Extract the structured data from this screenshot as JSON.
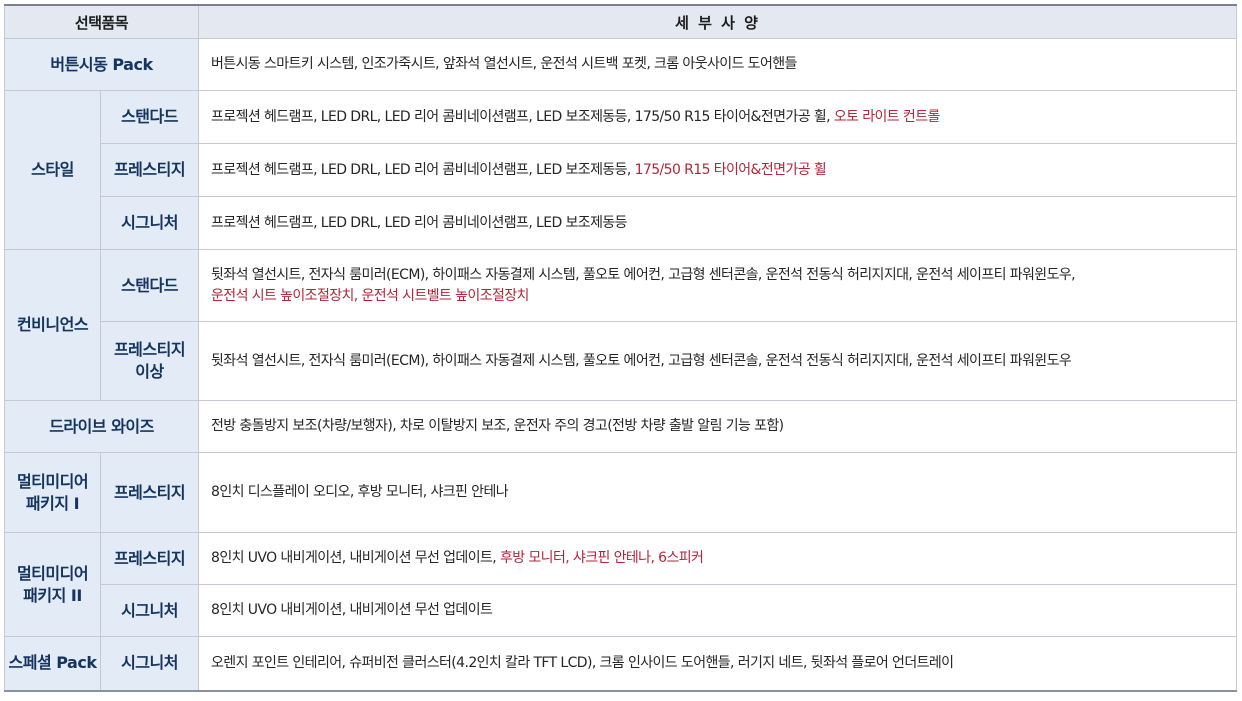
{
  "header": {
    "items": "선택품목",
    "specs": "세 부 사 양"
  },
  "rows": {
    "button_start": {
      "category": "버튼시동 Pack",
      "spec": "버튼시동 스마트키 시스템, 인조가죽시트, 앞좌석 열선시트, 운전석 시트백 포켓, 크롬 아웃사이드 도어핸들"
    },
    "style": {
      "category": "스타일",
      "standard": {
        "trim": "스탠다드",
        "spec": "프로젝션 헤드램프, LED DRL, LED 리어 콤비네이션램프, LED 보조제동등, 175/50 R15 타이어&전면가공 휠, ",
        "spec_red": "오토 라이트 컨트롤"
      },
      "prestige": {
        "trim": "프레스티지",
        "spec": "프로젝션 헤드램프, LED DRL, LED 리어 콤비네이션램프, LED 보조제동등, ",
        "spec_red": "175/50 R15 타이어&전면가공 휠"
      },
      "signature": {
        "trim": "시그니처",
        "spec": "프로젝션 헤드램프, LED DRL, LED 리어 콤비네이션램프, LED 보조제동등"
      }
    },
    "convenience": {
      "category": "컨비니언스",
      "standard": {
        "trim": "스탠다드",
        "spec": "뒷좌석 열선시트, 전자식 룸미러(ECM), 하이패스 자동결제 시스템, 풀오토 에어컨, 고급형 센터콘솔, 운전석 전동식 허리지지대, 운전석 세이프티 파워윈도우,",
        "spec_red": "운전석 시트 높이조절장치, 운전석 시트벨트 높이조절장치"
      },
      "prestige_up": {
        "trim_line1": "프레스티지",
        "trim_line2": "이상",
        "spec": "뒷좌석 열선시트, 전자식 룸미러(ECM), 하이패스 자동결제 시스템, 풀오토 에어컨, 고급형 센터콘솔, 운전석 전동식 허리지지대, 운전석 세이프티 파워윈도우"
      }
    },
    "drive_wise": {
      "category": "드라이브 와이즈",
      "spec": "전방 충돌방지 보조(차량/보행자), 차로 이탈방지 보조, 운전자 주의 경고(전방 차량 출발 알림 기능 포함)"
    },
    "multimedia1": {
      "category_line1": "멀티미디어",
      "category_line2": "패키지 I",
      "prestige": {
        "trim": "프레스티지",
        "spec": "8인치 디스플레이 오디오, 후방 모니터, 샤크핀 안테나"
      }
    },
    "multimedia2": {
      "category_line1": "멀티미디어",
      "category_line2": "패키지 II",
      "prestige": {
        "trim": "프레스티지",
        "spec": "8인치 UVO 내비게이션, 내비게이션 무선 업데이트, ",
        "spec_red": "후방 모니터, 샤크핀 안테나, 6스피커"
      },
      "signature": {
        "trim": "시그니처",
        "spec": "8인치 UVO 내비게이션, 내비게이션 무선 업데이트"
      }
    },
    "special": {
      "category": "스페셜 Pack",
      "signature": {
        "trim": "시그니처",
        "spec": "오렌지 포인트 인테리어, 슈퍼비전 클러스터(4.2인치 칼라 TFT LCD), 크롬 인사이드 도어핸들, 러기지 네트, 뒷좌석 플로어 언더트레이"
      }
    }
  },
  "colors": {
    "header_bg": "#e3e8f1",
    "label_bg": "#e3ebf6",
    "label_text": "#153560",
    "highlight": "#b3263a",
    "border": "#c4c9d2"
  }
}
